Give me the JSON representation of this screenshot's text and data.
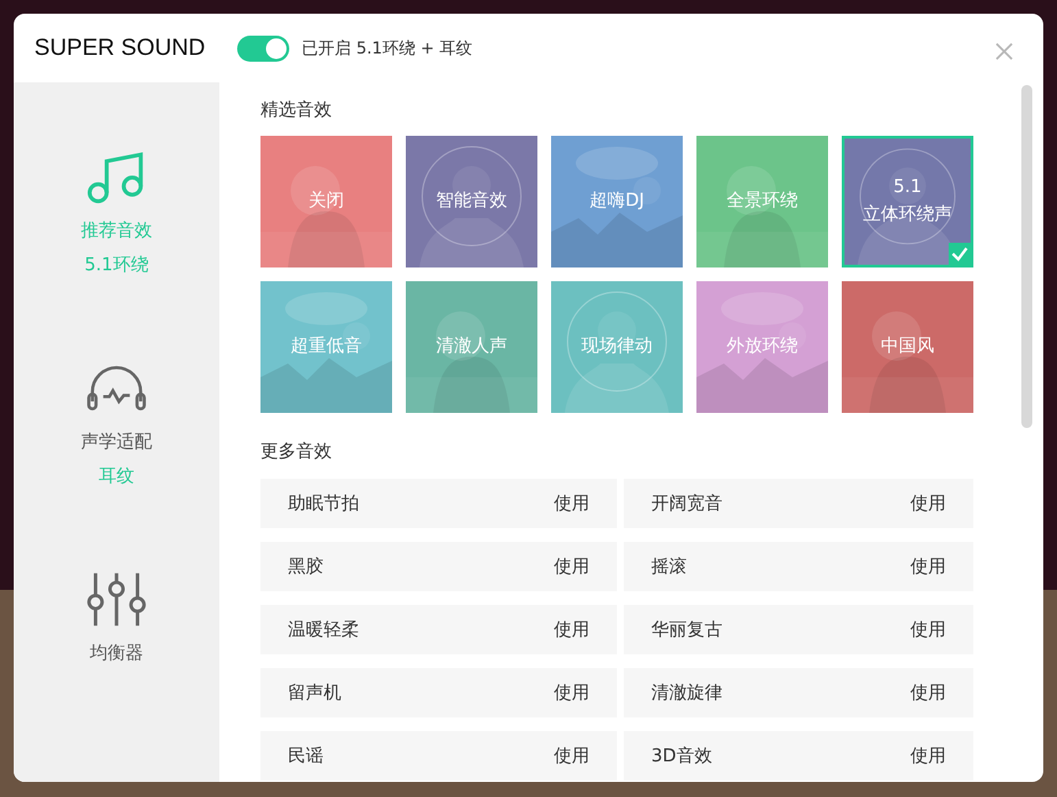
{
  "window": {
    "title": "SUPER SOUND"
  },
  "toggle": {
    "on": true,
    "status": "已开启 5.1环绕 + 耳纹"
  },
  "sidebar": {
    "items": [
      {
        "kind": "note",
        "label": "推荐音效",
        "sublabel": "5.1环绕",
        "selected": true
      },
      {
        "kind": "headphones",
        "label": "声学适配",
        "sublabel": "耳纹",
        "selected": false
      },
      {
        "kind": "equalizer",
        "label": "均衡器",
        "selected": false
      }
    ]
  },
  "featured": {
    "title": "精选音效",
    "tiles": [
      {
        "label": "关闭",
        "color": "#e88080",
        "selected": false
      },
      {
        "label": "智能音效",
        "color": "#7b78a8",
        "selected": false
      },
      {
        "label": "超嗨DJ",
        "color": "#6f9fd2",
        "selected": false
      },
      {
        "label": "全景环绕",
        "color": "#6cc48a",
        "selected": false
      },
      {
        "label": "5.1\n立体环绕声",
        "color": "#7478aa",
        "selected": true
      },
      {
        "label": "超重低音",
        "color": "#72c2cc",
        "selected": false
      },
      {
        "label": "清澈人声",
        "color": "#6ab6a4",
        "selected": false
      },
      {
        "label": "现场律动",
        "color": "#6cc0c0",
        "selected": false
      },
      {
        "label": "外放环绕",
        "color": "#d4a0d4",
        "selected": false
      },
      {
        "label": "中国风",
        "color": "#cc6a68",
        "selected": false
      }
    ]
  },
  "more": {
    "title": "更多音效",
    "items": [
      {
        "name": "助眠节拍",
        "action": "使用"
      },
      {
        "name": "开阔宽音",
        "action": "使用"
      },
      {
        "name": "黑胶",
        "action": "使用"
      },
      {
        "name": "摇滚",
        "action": "使用"
      },
      {
        "name": "温暖轻柔",
        "action": "使用"
      },
      {
        "name": "华丽复古",
        "action": "使用"
      },
      {
        "name": "留声机",
        "action": "使用"
      },
      {
        "name": "清澈旋律",
        "action": "使用"
      },
      {
        "name": "民谣",
        "action": "使用"
      },
      {
        "name": "3D音效",
        "action": "使用"
      }
    ]
  }
}
